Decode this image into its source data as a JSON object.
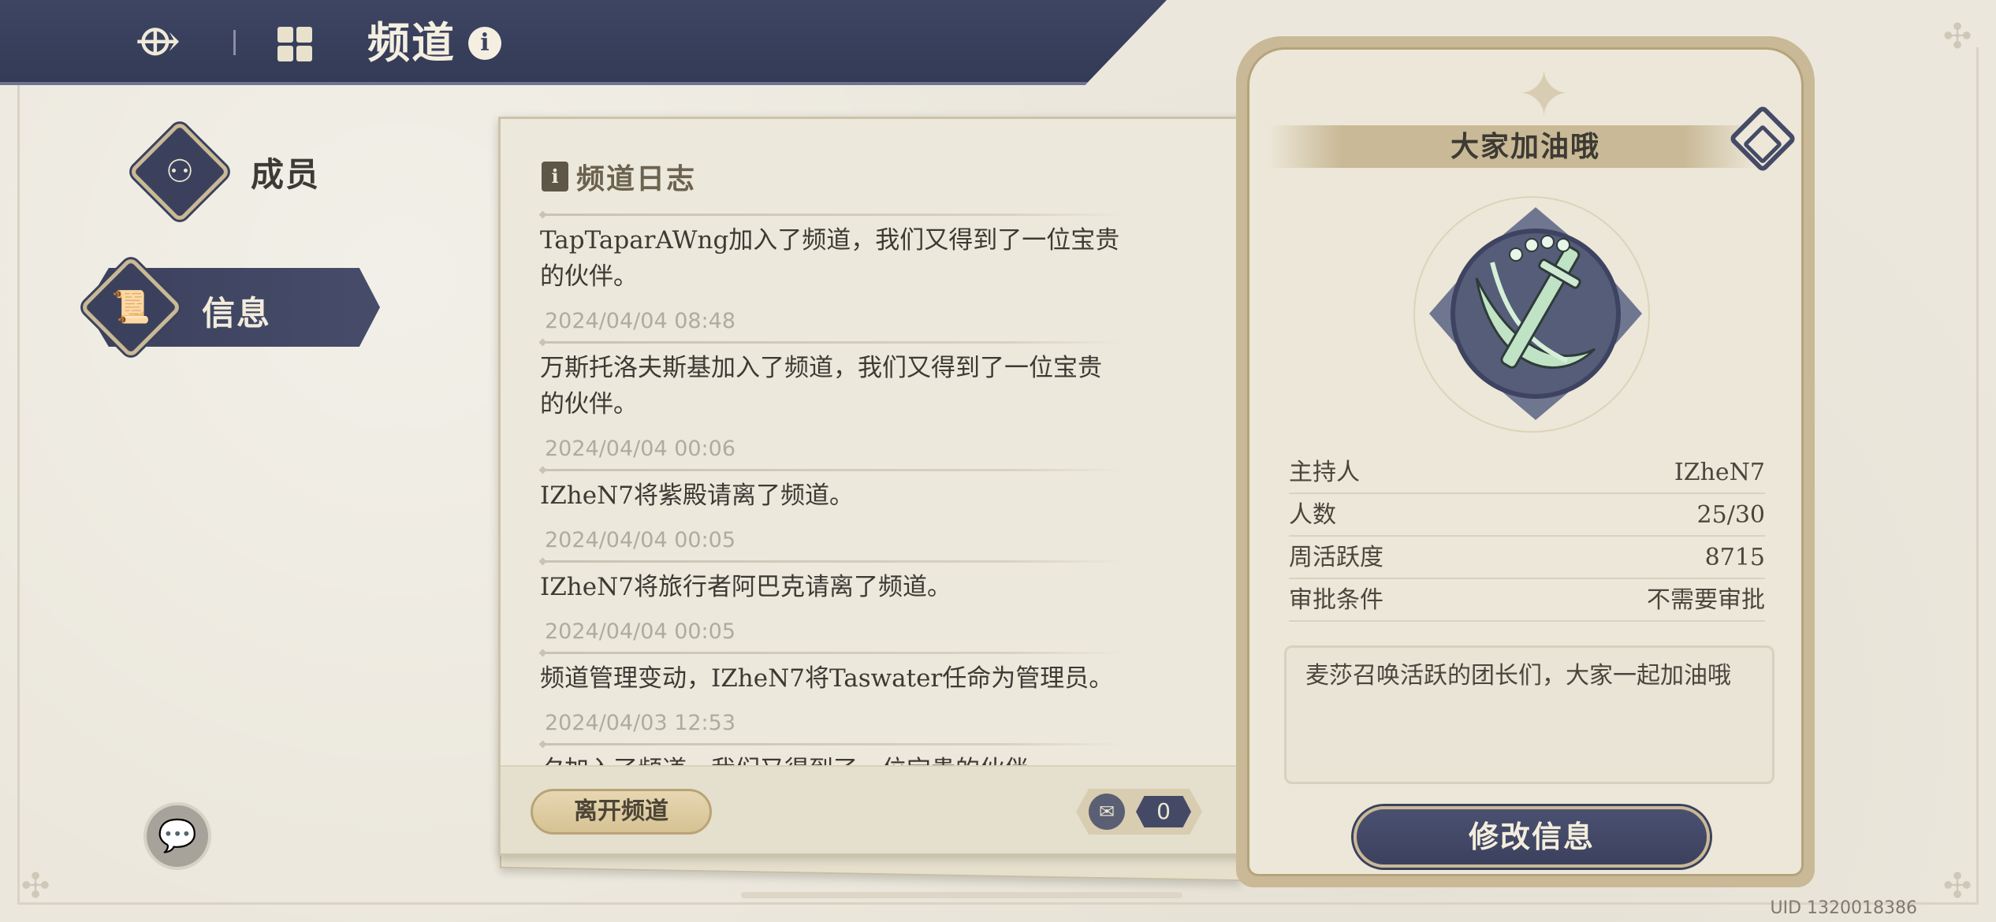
{
  "header": {
    "title": "频道",
    "back_icon": "trident-back-icon",
    "channel_icon": "grid-icon",
    "info_icon": "info-icon"
  },
  "nav": {
    "members_label": "成员",
    "info_label": "信息"
  },
  "log": {
    "title": "频道日志",
    "entries": [
      {
        "message": "TapTaparAWng加入了频道，我们又得到了一位宝贵的伙伴。",
        "time": "2024/04/04 08:48"
      },
      {
        "message": "万斯托洛夫斯基加入了频道，我们又得到了一位宝贵的伙伴。",
        "time": "2024/04/04 00:06"
      },
      {
        "message": "IZheN7将紫殿请离了频道。",
        "time": "2024/04/04 00:05"
      },
      {
        "message": "IZheN7将旅行者阿巴克请离了频道。",
        "time": "2024/04/04 00:05"
      },
      {
        "message": "频道管理变动，IZheN7将Taswater任命为管理员。",
        "time": "2024/04/03 12:53"
      },
      {
        "message": "夕加入了频道，我们又得到了一位宝贵的伙伴。",
        "time": ""
      }
    ],
    "leave_button": "离开频道",
    "mail_count": "0"
  },
  "card": {
    "name": "大家加油哦",
    "stats": [
      {
        "label": "主持人",
        "value": "IZheN7"
      },
      {
        "label": "人数",
        "value": "25/30"
      },
      {
        "label": "周活跃度",
        "value": "8715"
      },
      {
        "label": "审批条件",
        "value": "不需要审批"
      }
    ],
    "description": "麦莎召唤活跃的团长们，大家一起加油哦",
    "edit_button": "修改信息"
  },
  "uid": "UID 1320018386",
  "colors": {
    "navy": "#3b415d",
    "gold": "#c9b996",
    "paper": "#ece8dc",
    "emblem_green": "#bfe3c4"
  }
}
